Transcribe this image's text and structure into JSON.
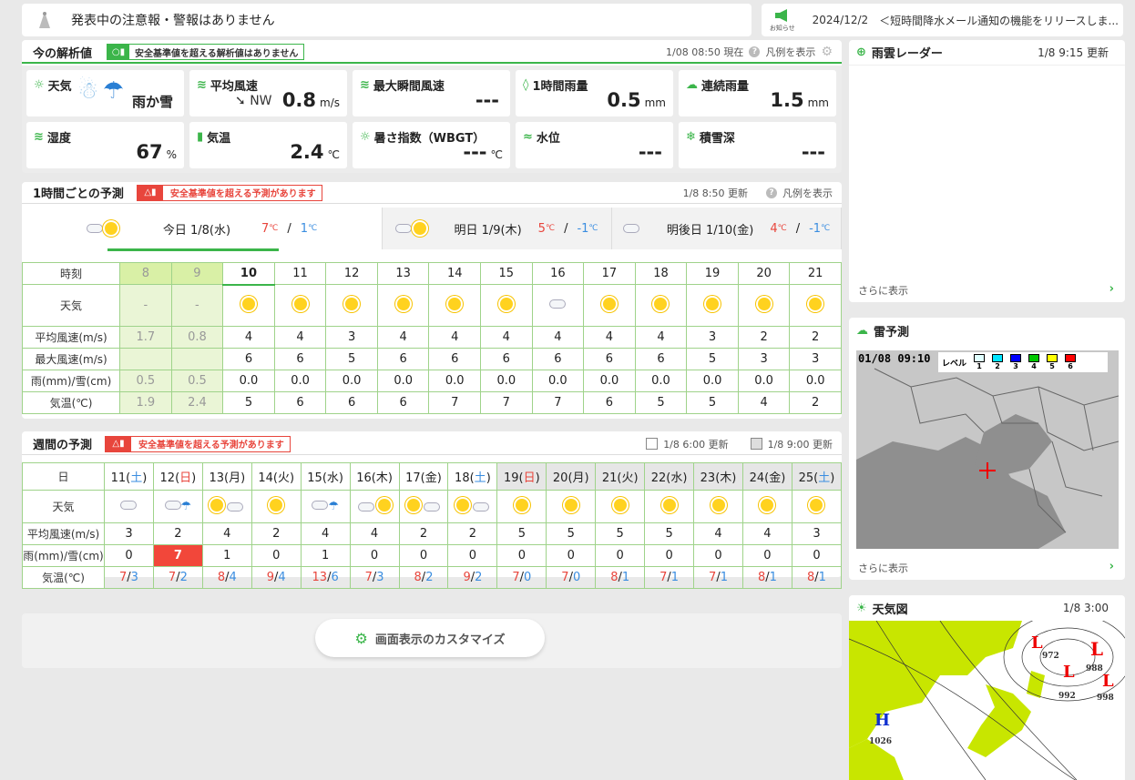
{
  "alert_bar": {
    "text": "発表中の注意報・警報はありません"
  },
  "news": {
    "icon_label": "お知らせ",
    "date": "2024/12/2",
    "text": "＜短時間降水メール通知の機能をリリースしま..."
  },
  "current": {
    "title": "今の解析値",
    "badge": "安全基準値を超える解析値はありません",
    "timestamp": "1/08 08:50 現在",
    "legend": "凡例を表示",
    "tiles": [
      {
        "label": "天気",
        "value": "雨か雪",
        "unit": ""
      },
      {
        "label": "平均風速",
        "dir": "NW",
        "value": "0.8",
        "unit": "m/s"
      },
      {
        "label": "最大瞬間風速",
        "value": "---",
        "unit": ""
      },
      {
        "label": "1時間雨量",
        "value": "0.5",
        "unit": "mm"
      },
      {
        "label": "連続雨量",
        "value": "1.5",
        "unit": "mm"
      },
      {
        "label": "湿度",
        "value": "67",
        "unit": "%"
      },
      {
        "label": "気温",
        "value": "2.4",
        "unit": "℃"
      },
      {
        "label": "暑さ指数（WBGT）",
        "value": "---",
        "unit": "℃"
      },
      {
        "label": "水位",
        "value": "---",
        "unit": ""
      },
      {
        "label": "積雪深",
        "value": "---",
        "unit": ""
      }
    ]
  },
  "hourly": {
    "title": "1時間ごとの予測",
    "badge": "安全基準値を超える予測があります",
    "updated": "1/8 8:50 更新",
    "legend": "凡例を表示",
    "days": [
      {
        "label": "今日 1/8(水)",
        "hi": "7",
        "lo": "1"
      },
      {
        "label": "明日 1/9(木)",
        "hi": "5",
        "lo": "-1"
      },
      {
        "label": "明後日 1/10(金)",
        "hi": "4",
        "lo": "-1"
      }
    ],
    "deg": "℃",
    "row_labels": [
      "時刻",
      "天気",
      "平均風速(m/s)",
      "最大風速(m/s)",
      "雨(mm)/雪(cm)",
      "気温(℃)"
    ],
    "hours": [
      "8",
      "9",
      "10",
      "11",
      "12",
      "13",
      "14",
      "15",
      "16",
      "17",
      "18",
      "19",
      "20",
      "21"
    ],
    "weather": [
      "-",
      "-",
      "sun",
      "sun",
      "sun",
      "sun",
      "sun",
      "sun",
      "cloud",
      "sun",
      "sun",
      "sun",
      "sun",
      "sun"
    ],
    "avg_wind": [
      "1.7",
      "0.8",
      "4",
      "4",
      "3",
      "4",
      "4",
      "4",
      "4",
      "4",
      "4",
      "3",
      "2",
      "2"
    ],
    "max_wind": [
      "",
      "",
      "6",
      "6",
      "5",
      "6",
      "6",
      "6",
      "6",
      "6",
      "6",
      "5",
      "3",
      "3"
    ],
    "precip": [
      "0.5",
      "0.5",
      "0.0",
      "0.0",
      "0.0",
      "0.0",
      "0.0",
      "0.0",
      "0.0",
      "0.0",
      "0.0",
      "0.0",
      "0.0",
      "0.0"
    ],
    "temp": [
      "1.9",
      "2.4",
      "5",
      "6",
      "6",
      "6",
      "7",
      "7",
      "7",
      "6",
      "5",
      "5",
      "4",
      "2"
    ]
  },
  "weekly": {
    "title": "週間の予測",
    "badge": "安全基準値を超える予測があります",
    "updated1": "1/8 6:00 更新",
    "updated2": "1/8 9:00 更新",
    "row_labels": [
      "日",
      "天気",
      "平均風速(m/s)",
      "雨(mm)/雪(cm)",
      "気温(℃)"
    ],
    "days": [
      {
        "d": "11",
        "w": "土",
        "type": "sat"
      },
      {
        "d": "12",
        "w": "日",
        "type": "sun"
      },
      {
        "d": "13",
        "w": "月",
        "type": ""
      },
      {
        "d": "14",
        "w": "火",
        "type": ""
      },
      {
        "d": "15",
        "w": "水",
        "type": ""
      },
      {
        "d": "16",
        "w": "木",
        "type": ""
      },
      {
        "d": "17",
        "w": "金",
        "type": ""
      },
      {
        "d": "18",
        "w": "土",
        "type": "sat"
      },
      {
        "d": "19",
        "w": "日",
        "type": "sun"
      },
      {
        "d": "20",
        "w": "月",
        "type": ""
      },
      {
        "d": "21",
        "w": "火",
        "type": ""
      },
      {
        "d": "22",
        "w": "水",
        "type": ""
      },
      {
        "d": "23",
        "w": "木",
        "type": ""
      },
      {
        "d": "24",
        "w": "金",
        "type": ""
      },
      {
        "d": "25",
        "w": "土",
        "type": "sat"
      }
    ],
    "weather": [
      "cloud",
      "cloud-rain",
      "sun-cloud",
      "sun",
      "cloud-rain",
      "cloud-sun",
      "sun-cloud",
      "sun-cloud",
      "sun",
      "sun",
      "sun",
      "sun",
      "sun",
      "sun",
      "sun"
    ],
    "avg_wind": [
      "3",
      "2",
      "4",
      "2",
      "4",
      "4",
      "2",
      "2",
      "5",
      "5",
      "5",
      "5",
      "4",
      "4",
      "3"
    ],
    "precip": [
      "0",
      "7",
      "1",
      "0",
      "1",
      "0",
      "0",
      "0",
      "0",
      "0",
      "0",
      "0",
      "0",
      "0",
      "0"
    ],
    "hi": [
      "7",
      "7",
      "8",
      "9",
      "13",
      "7",
      "8",
      "9",
      "7",
      "7",
      "8",
      "7",
      "7",
      "8",
      "8"
    ],
    "lo": [
      "3",
      "2",
      "4",
      "4",
      "6",
      "3",
      "2",
      "2",
      "0",
      "0",
      "1",
      "1",
      "1",
      "1",
      "1"
    ]
  },
  "customize": {
    "label": "画面表示のカスタマイズ"
  },
  "radar": {
    "title": "雨雲レーダー",
    "updated": "1/8 9:15 更新",
    "more": "さらに表示"
  },
  "thunder": {
    "title": "雷予測",
    "map_time": "01/08 09:10",
    "level_label": "レベル",
    "levels": [
      "1",
      "2",
      "3",
      "4",
      "5",
      "6"
    ],
    "level_colors": [
      "#e0ffff",
      "#00e5ff",
      "#0000ff",
      "#00c800",
      "#ffff00",
      "#ff0000"
    ],
    "more": "さらに表示"
  },
  "weather_map": {
    "title": "天気図",
    "updated": "1/8 3:00",
    "pressures": [
      "972",
      "988",
      "992",
      "998",
      "1026"
    ]
  }
}
